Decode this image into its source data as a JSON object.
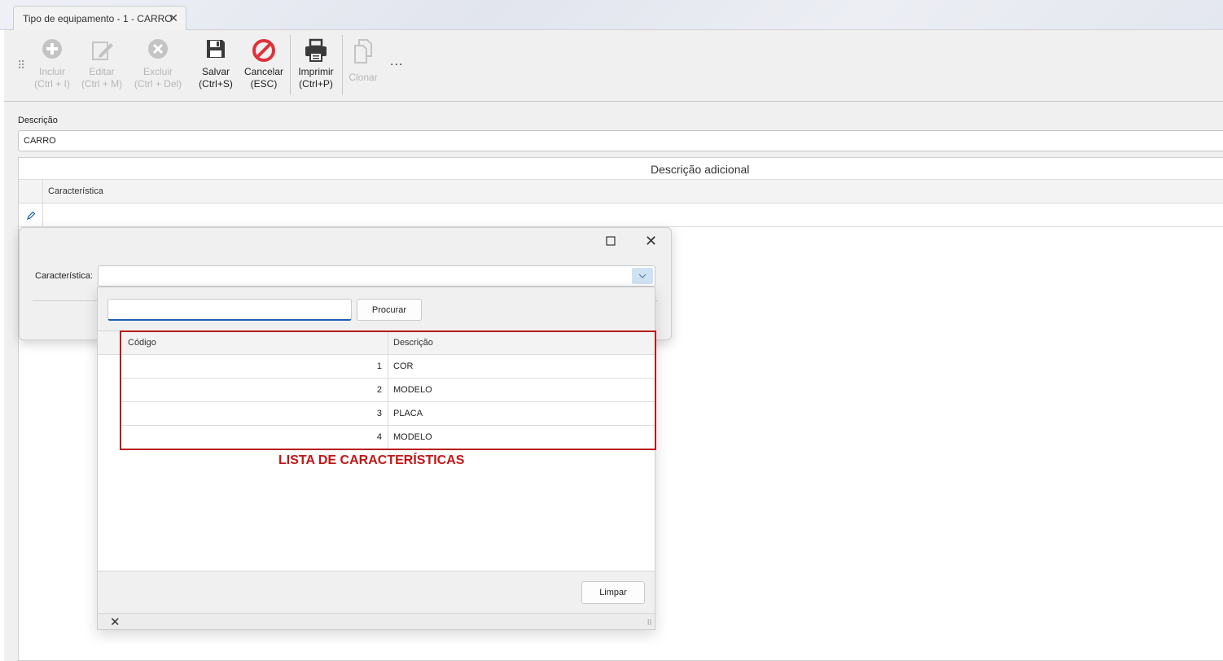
{
  "tab": {
    "title": "Tipo de equipamento - 1 - CARRO",
    "close": "✕"
  },
  "toolbar": {
    "buttons": [
      {
        "label1": "Incluir",
        "label2": "(Ctrl + I)",
        "icon": "plus-circle-icon"
      },
      {
        "label1": "Editar",
        "label2": "(Ctrl + M)",
        "icon": "edit-icon"
      },
      {
        "label1": "Excluir",
        "label2": "(Ctrl + Del)",
        "icon": "delete-circle-icon"
      },
      {
        "label1": "Salvar",
        "label2": "(Ctrl+S)",
        "icon": "floppy-disk-icon"
      },
      {
        "label1": "Cancelar",
        "label2": "(ESC)",
        "icon": "cancel-icon"
      },
      {
        "label1": "Imprimir",
        "label2": "(Ctrl+P)",
        "icon": "printer-icon"
      },
      {
        "label1": "Clonar",
        "label2": "",
        "icon": "clone-icon"
      }
    ],
    "more": "..."
  },
  "form": {
    "descricao_label": "Descrição",
    "descricao_value": "CARRO"
  },
  "grid": {
    "band_title": "Descrição adicional",
    "column": "Característica"
  },
  "dialog": {
    "field_label": "Característica:",
    "field_value": ""
  },
  "popup": {
    "search_value": "",
    "search_button": "Procurar",
    "columns": [
      "Código",
      "Descrição"
    ],
    "rows": [
      {
        "code": "1",
        "desc": "COR"
      },
      {
        "code": "2",
        "desc": "MODELO"
      },
      {
        "code": "3",
        "desc": "PLACA"
      },
      {
        "code": "4",
        "desc": "MODELO"
      }
    ],
    "clear_button": "Limpar",
    "close": "✕"
  },
  "annotation": {
    "label": "LISTA DE CARACTERÍSTICAS",
    "color": "#c01616"
  },
  "colors": {
    "accent": "#1a5fb4",
    "cancel_red": "#e0313a",
    "highlight_box": "#b81c1c"
  }
}
